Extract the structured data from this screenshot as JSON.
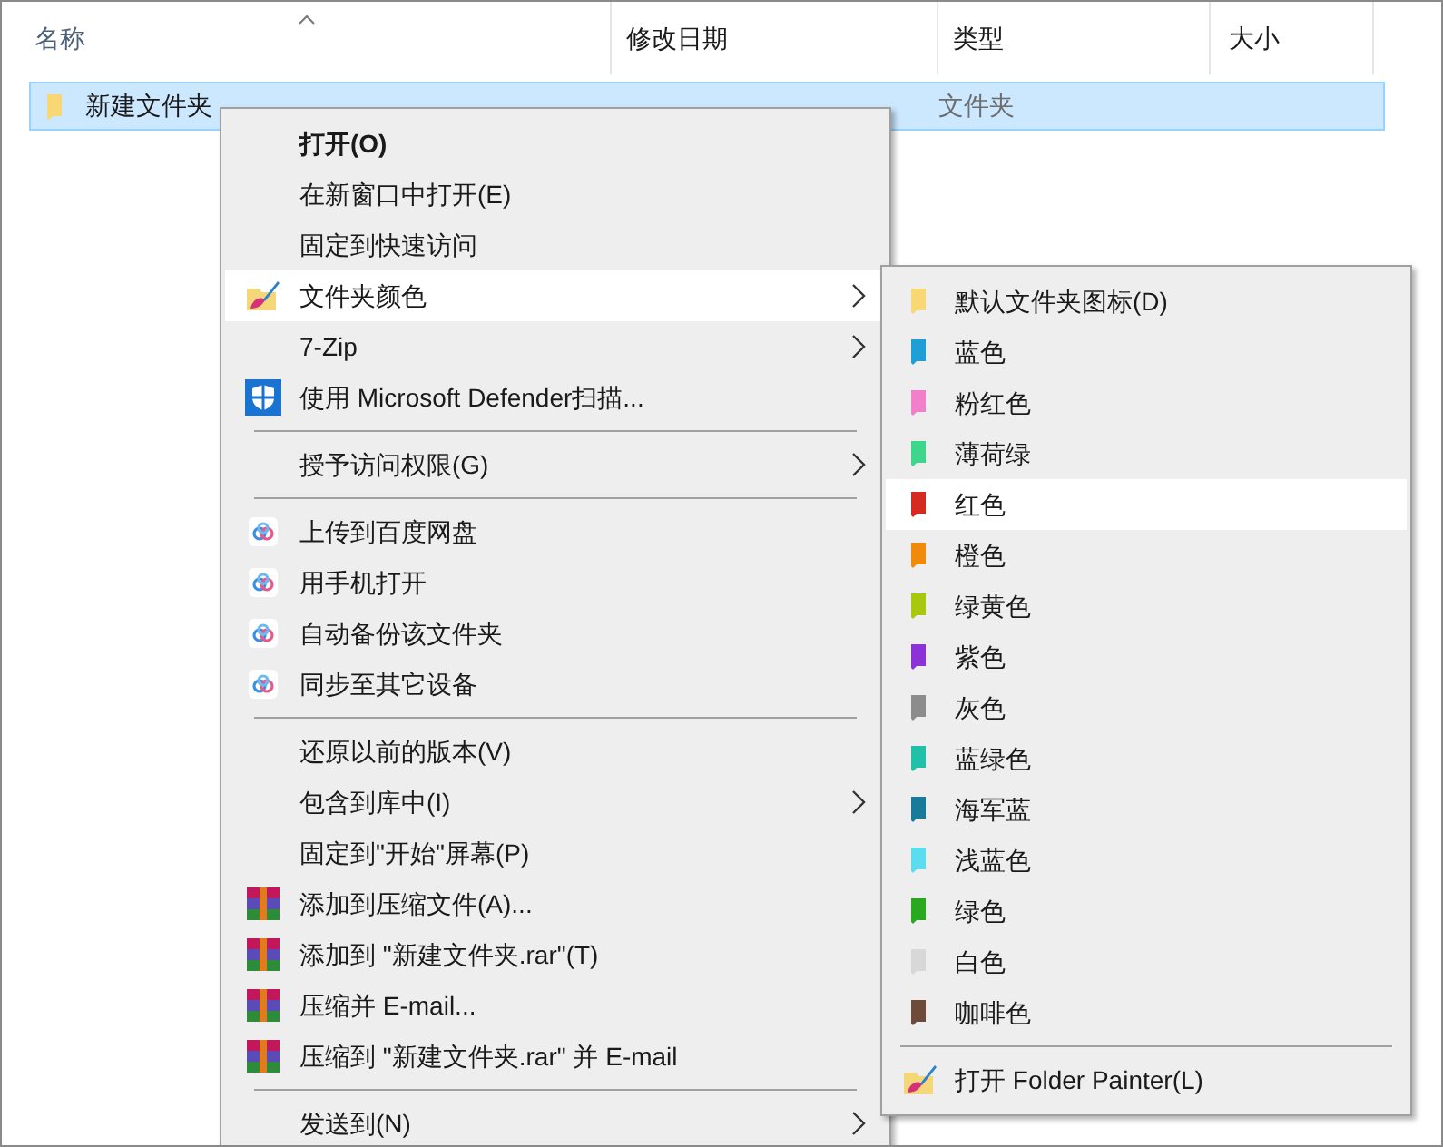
{
  "columns": [
    {
      "label": "名称",
      "sorted": true
    },
    {
      "label": "修改日期",
      "sorted": false
    },
    {
      "label": "类型",
      "sorted": false
    },
    {
      "label": "大小",
      "sorted": false
    }
  ],
  "files": [
    {
      "name": "新建文件夹",
      "type": "文件夹",
      "selected": true
    }
  ],
  "context_menu": [
    {
      "kind": "plain",
      "label": "打开(O)",
      "bold": true,
      "submenu": false,
      "selected": false
    },
    {
      "kind": "plain",
      "label": "在新窗口中打开(E)",
      "bold": false,
      "submenu": false,
      "selected": false
    },
    {
      "kind": "plain",
      "label": "固定到快速访问",
      "bold": false,
      "submenu": false,
      "selected": false
    },
    {
      "kind": "painter",
      "label": "文件夹颜色",
      "bold": false,
      "submenu": true,
      "selected": true
    },
    {
      "kind": "plain",
      "label": "7-Zip",
      "bold": false,
      "submenu": true,
      "selected": false
    },
    {
      "kind": "shield",
      "label": "使用 Microsoft Defender扫描...",
      "bold": false,
      "submenu": false,
      "selected": false
    },
    {
      "kind": "separator"
    },
    {
      "kind": "plain",
      "label": "授予访问权限(G)",
      "bold": false,
      "submenu": true,
      "selected": false
    },
    {
      "kind": "separator"
    },
    {
      "kind": "cloud",
      "label": "上传到百度网盘",
      "bold": false,
      "submenu": false,
      "selected": false
    },
    {
      "kind": "cloud",
      "label": "用手机打开",
      "bold": false,
      "submenu": false,
      "selected": false
    },
    {
      "kind": "cloud",
      "label": "自动备份该文件夹",
      "bold": false,
      "submenu": false,
      "selected": false
    },
    {
      "kind": "cloud",
      "label": "同步至其它设备",
      "bold": false,
      "submenu": false,
      "selected": false
    },
    {
      "kind": "separator"
    },
    {
      "kind": "plain",
      "label": "还原以前的版本(V)",
      "bold": false,
      "submenu": false,
      "selected": false
    },
    {
      "kind": "plain",
      "label": "包含到库中(I)",
      "bold": false,
      "submenu": true,
      "selected": false
    },
    {
      "kind": "plain",
      "label": "固定到\"开始\"屏幕(P)",
      "bold": false,
      "submenu": false,
      "selected": false
    },
    {
      "kind": "archive",
      "label": "添加到压缩文件(A)...",
      "bold": false,
      "submenu": false,
      "selected": false
    },
    {
      "kind": "archive",
      "label": "添加到 \"新建文件夹.rar\"(T)",
      "bold": false,
      "submenu": false,
      "selected": false
    },
    {
      "kind": "archive",
      "label": "压缩并 E-mail...",
      "bold": false,
      "submenu": false,
      "selected": false
    },
    {
      "kind": "archive",
      "label": "压缩到 \"新建文件夹.rar\" 并 E-mail",
      "bold": false,
      "submenu": false,
      "selected": false
    },
    {
      "kind": "separator"
    },
    {
      "kind": "plain",
      "label": "发送到(N)",
      "bold": false,
      "submenu": true,
      "selected": false
    }
  ],
  "color_submenu": [
    {
      "kind": "color",
      "label": "默认文件夹图标(D)",
      "color": "#f8d775",
      "selected": false
    },
    {
      "kind": "color",
      "label": "蓝色",
      "color": "#1e9fd8",
      "selected": false
    },
    {
      "kind": "color",
      "label": "粉红色",
      "color": "#f27fcb",
      "selected": false
    },
    {
      "kind": "color",
      "label": "薄荷绿",
      "color": "#3dd68c",
      "selected": false
    },
    {
      "kind": "color",
      "label": "红色",
      "color": "#d42a20",
      "selected": true
    },
    {
      "kind": "color",
      "label": "橙色",
      "color": "#ef8a0a",
      "selected": false
    },
    {
      "kind": "color",
      "label": "绿黄色",
      "color": "#a8c70f",
      "selected": false
    },
    {
      "kind": "color",
      "label": "紫色",
      "color": "#8a33d6",
      "selected": false
    },
    {
      "kind": "color",
      "label": "灰色",
      "color": "#8c8c8c",
      "selected": false
    },
    {
      "kind": "color",
      "label": "蓝绿色",
      "color": "#22c0a8",
      "selected": false
    },
    {
      "kind": "color",
      "label": "海军蓝",
      "color": "#1a7a9a",
      "selected": false
    },
    {
      "kind": "color",
      "label": "浅蓝色",
      "color": "#5cdcef",
      "selected": false
    },
    {
      "kind": "color",
      "label": "绿色",
      "color": "#2aa81f",
      "selected": false
    },
    {
      "kind": "color",
      "label": "白色",
      "color": "#d8d8d8",
      "selected": false
    },
    {
      "kind": "color",
      "label": "咖啡色",
      "color": "#6e4a3a",
      "selected": false
    },
    {
      "kind": "separator"
    },
    {
      "kind": "action",
      "label": "打开 Folder Painter(L)",
      "selected": false
    }
  ]
}
